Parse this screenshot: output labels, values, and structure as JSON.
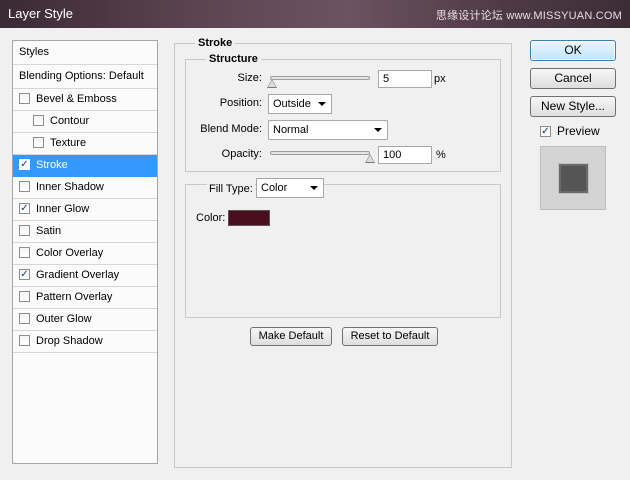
{
  "window": {
    "title": "Layer Style",
    "watermark": "思缘设计论坛 www.MISSYUAN.COM"
  },
  "styles_list": {
    "header": "Styles",
    "blending": "Blending Options: Default",
    "items": [
      {
        "label": "Bevel & Emboss",
        "checked": false
      },
      {
        "label": "Contour",
        "checked": false
      },
      {
        "label": "Texture",
        "checked": false
      },
      {
        "label": "Stroke",
        "checked": true,
        "selected": true
      },
      {
        "label": "Inner Shadow",
        "checked": false
      },
      {
        "label": "Inner Glow",
        "checked": true
      },
      {
        "label": "Satin",
        "checked": false
      },
      {
        "label": "Color Overlay",
        "checked": false
      },
      {
        "label": "Gradient Overlay",
        "checked": true
      },
      {
        "label": "Pattern Overlay",
        "checked": false
      },
      {
        "label": "Outer Glow",
        "checked": false
      },
      {
        "label": "Drop Shadow",
        "checked": false
      }
    ]
  },
  "stroke": {
    "title": "Stroke",
    "structure_title": "Structure",
    "size_label": "Size:",
    "size_value": "5",
    "size_unit": "px",
    "size_fraction": 0.02,
    "position_label": "Position:",
    "position_value": "Outside",
    "blend_label": "Blend Mode:",
    "blend_value": "Normal",
    "opacity_label": "Opacity:",
    "opacity_value": "100",
    "opacity_unit": "%",
    "opacity_fraction": 1.0,
    "filltype_label": "Fill Type:",
    "filltype_value": "Color",
    "color_label": "Color:",
    "color_hex": "#4a0f1e",
    "make_default": "Make Default",
    "reset_default": "Reset to Default"
  },
  "right": {
    "ok": "OK",
    "cancel": "Cancel",
    "new_style": "New Style...",
    "preview_label": "Preview",
    "preview_checked": true
  }
}
